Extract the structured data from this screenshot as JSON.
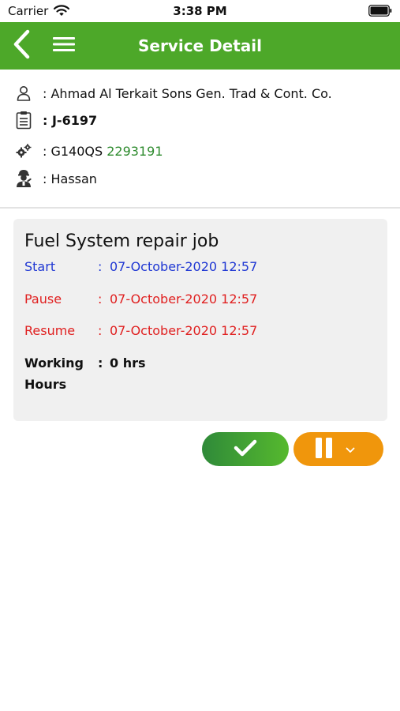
{
  "status_bar": {
    "carrier": "Carrier",
    "time": "3:38 PM"
  },
  "navbar": {
    "title": "Service Detail",
    "back_icon": "chevron-left-icon",
    "menu_icon": "hamburger-menu-icon"
  },
  "info": {
    "customer": ": Ahmad Al Terkait Sons Gen. Trad & Cont. Co.",
    "job_number": ": J-6197",
    "model_prefix": ": G140QS ",
    "serial": "2293191",
    "technician": ": Hassan"
  },
  "task": {
    "title": "Fuel System repair job",
    "start_label": "Start",
    "start_value": "07-October-2020 12:57",
    "pause_label": "Pause",
    "pause_value": "07-October-2020 12:57",
    "resume_label": "Resume",
    "resume_value": "07-October-2020 12:57",
    "hours_label_line1": "Working",
    "hours_label_line2": "Hours",
    "hours_value": "0 hrs",
    "colon": ":"
  },
  "colors": {
    "green": "#4da829",
    "blue": "#1f37d3",
    "red": "#e02020",
    "orange": "#f0960c",
    "serial_green": "#2e8b2e"
  },
  "icons": [
    "user-icon",
    "clipboard-icon",
    "gears-icon",
    "mechanic-icon",
    "checkmark-icon",
    "pause-icon",
    "chevron-down-icon"
  ]
}
